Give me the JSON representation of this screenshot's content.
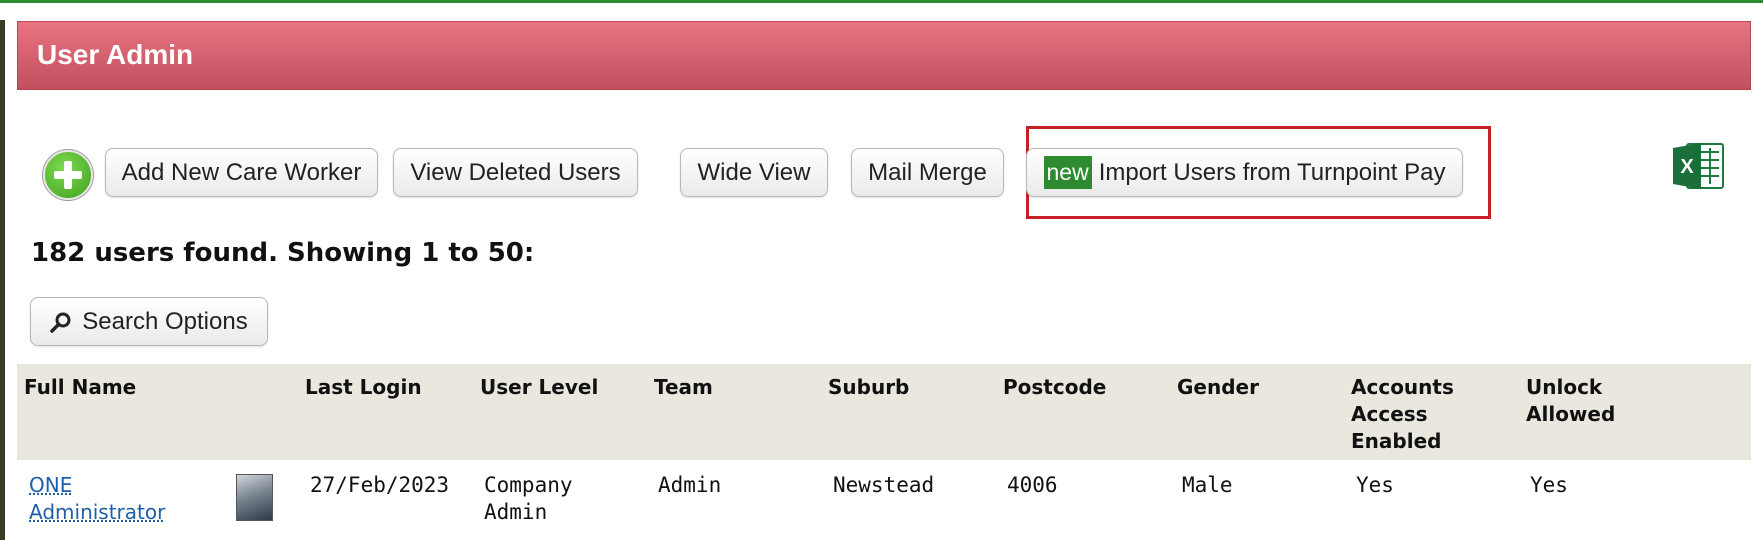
{
  "header": {
    "title": "User Admin"
  },
  "toolbar": {
    "add_new_care_worker": "Add New Care Worker",
    "view_deleted_users": "View Deleted Users",
    "wide_view": "Wide View",
    "mail_merge": "Mail Merge",
    "new_badge": "new",
    "import_users": "Import Users from Turnpoint Pay",
    "export_icon": "excel-icon",
    "add_icon": "plus-circle-icon"
  },
  "results": {
    "summary": "182 users found. Showing 1 to 50:"
  },
  "search": {
    "label": "Search Options",
    "icon": "search-icon"
  },
  "table": {
    "columns": [
      "Full Name",
      "Last Login",
      "User Level",
      "Team",
      "Suburb",
      "Postcode",
      "Gender",
      "Accounts Access Enabled",
      "Unlock Allowed"
    ],
    "rows": [
      {
        "full_name": "ONE Administrator",
        "last_login": "27/Feb/2023",
        "user_level": "Company Admin",
        "team": "Admin",
        "suburb": "Newstead",
        "postcode": "4006",
        "gender": "Male",
        "accounts_access_enabled": "Yes",
        "unlock_allowed": "Yes"
      }
    ]
  },
  "colors": {
    "header_top": "#e87481",
    "header_bottom": "#c24f5e",
    "highlight_border": "#c42026",
    "new_badge": "#2e8a2e",
    "table_header_bg": "#e9e7de",
    "link": "#1f5fa8"
  }
}
